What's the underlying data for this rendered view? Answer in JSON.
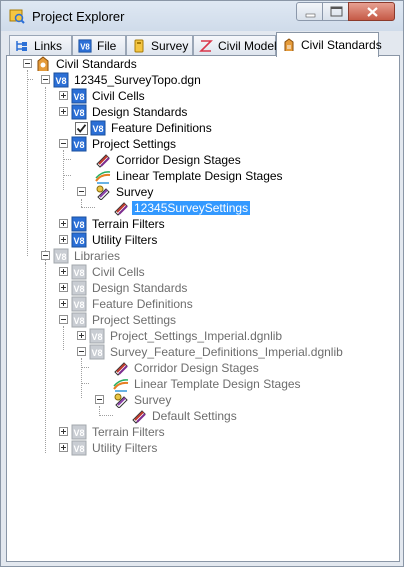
{
  "window": {
    "title": "Project Explorer",
    "icon": "project-explorer-icon"
  },
  "tabs": [
    {
      "label": "Links",
      "icon": "links-icon",
      "active": false
    },
    {
      "label": "File",
      "icon": "dgn-file-icon",
      "active": false
    },
    {
      "label": "Survey",
      "icon": "survey-icon",
      "active": false
    },
    {
      "label": "Civil Model",
      "icon": "civil-model-icon",
      "active": false
    },
    {
      "label": "Civil Standards",
      "icon": "civil-standards-icon",
      "active": true
    }
  ],
  "tree": {
    "root": "Civil Standards",
    "dgn": "12345_SurveyTopo.dgn",
    "civil_cells": "Civil Cells",
    "design_standards": "Design Standards",
    "feature_definitions": "Feature Definitions",
    "feature_definitions_checked": true,
    "project_settings": "Project Settings",
    "corridor_design_stages": "Corridor Design Stages",
    "linear_template_design_stages": "Linear Template Design Stages",
    "survey": "Survey",
    "survey_settings": "12345SurveySettings",
    "terrain_filters": "Terrain Filters",
    "utility_filters": "Utility Filters",
    "libraries": "Libraries",
    "lib_civil_cells": "Civil Cells",
    "lib_design_standards": "Design Standards",
    "lib_feature_definitions": "Feature Definitions",
    "lib_project_settings": "Project Settings",
    "lib_project_settings_imperial": "Project_Settings_Imperial.dgnlib",
    "lib_survey_feature_defs": "Survey_Feature_Definitions_Imperial.dgnlib",
    "lib_corridor_design_stages": "Corridor Design Stages",
    "lib_linear_template_design_stages": "Linear Template Design Stages",
    "lib_survey": "Survey",
    "lib_default_settings": "Default Settings",
    "lib_terrain_filters": "Terrain Filters",
    "lib_utility_filters": "Utility Filters"
  },
  "colors": {
    "selection": "#3399ff",
    "dgn_blue": "#2b6fd6",
    "dim_text": "#6d6d6d"
  }
}
